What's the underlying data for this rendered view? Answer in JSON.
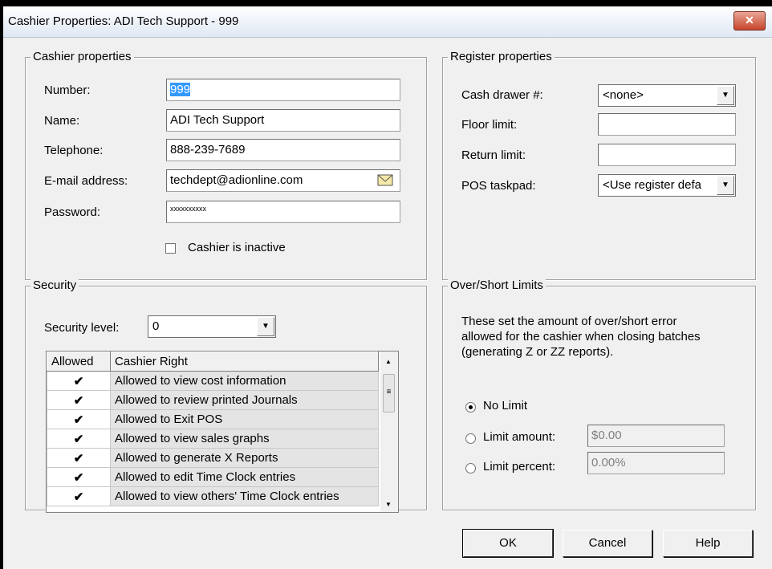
{
  "window": {
    "title": "Cashier Properties: ADI Tech Support - 999",
    "close_glyph": "✕"
  },
  "cashier": {
    "group_title": "Cashier properties",
    "number": {
      "label": "Number:",
      "value": "999"
    },
    "name": {
      "label": "Name:",
      "value": "ADI Tech Support"
    },
    "telephone": {
      "label": "Telephone:",
      "value": "888-239-7689"
    },
    "email": {
      "label": "E-mail address:",
      "value": "techdept@adionline.com"
    },
    "password": {
      "label": "Password:",
      "value": "xxxxxxxxxx"
    },
    "inactive": {
      "label": "Cashier is inactive",
      "checked": false
    }
  },
  "register": {
    "group_title": "Register properties",
    "cash_drawer": {
      "label": "Cash drawer #:",
      "value": "<none>"
    },
    "floor_limit": {
      "label": "Floor limit:",
      "value": ""
    },
    "return_limit": {
      "label": "Return limit:",
      "value": ""
    },
    "pos_taskpad": {
      "label": "POS taskpad:",
      "value": "<Use register defa"
    }
  },
  "security": {
    "group_title": "Security",
    "level_label": "Security level:",
    "level_value": "0",
    "columns": [
      "Allowed",
      "Cashier Right"
    ],
    "rows": [
      {
        "allowed": true,
        "right": "Allowed to view cost information"
      },
      {
        "allowed": true,
        "right": "Allowed to review printed Journals"
      },
      {
        "allowed": true,
        "right": "Allowed to Exit POS"
      },
      {
        "allowed": true,
        "right": "Allowed to view sales graphs"
      },
      {
        "allowed": true,
        "right": "Allowed to generate X Reports"
      },
      {
        "allowed": true,
        "right": "Allowed to edit Time Clock entries"
      },
      {
        "allowed": true,
        "right": "Allowed to view others' Time Clock entries"
      }
    ]
  },
  "overshort": {
    "group_title": "Over/Short Limits",
    "description": "These set the amount of over/short error allowed for the cashier when closing batches (generating Z or ZZ reports).",
    "options": [
      {
        "label": "No Limit",
        "selected": true,
        "value": null
      },
      {
        "label": "Limit amount:",
        "selected": false,
        "value": "$0.00"
      },
      {
        "label": "Limit percent:",
        "selected": false,
        "value": "0.00%"
      }
    ]
  },
  "buttons": {
    "ok": "OK",
    "cancel": "Cancel",
    "help": "Help"
  }
}
